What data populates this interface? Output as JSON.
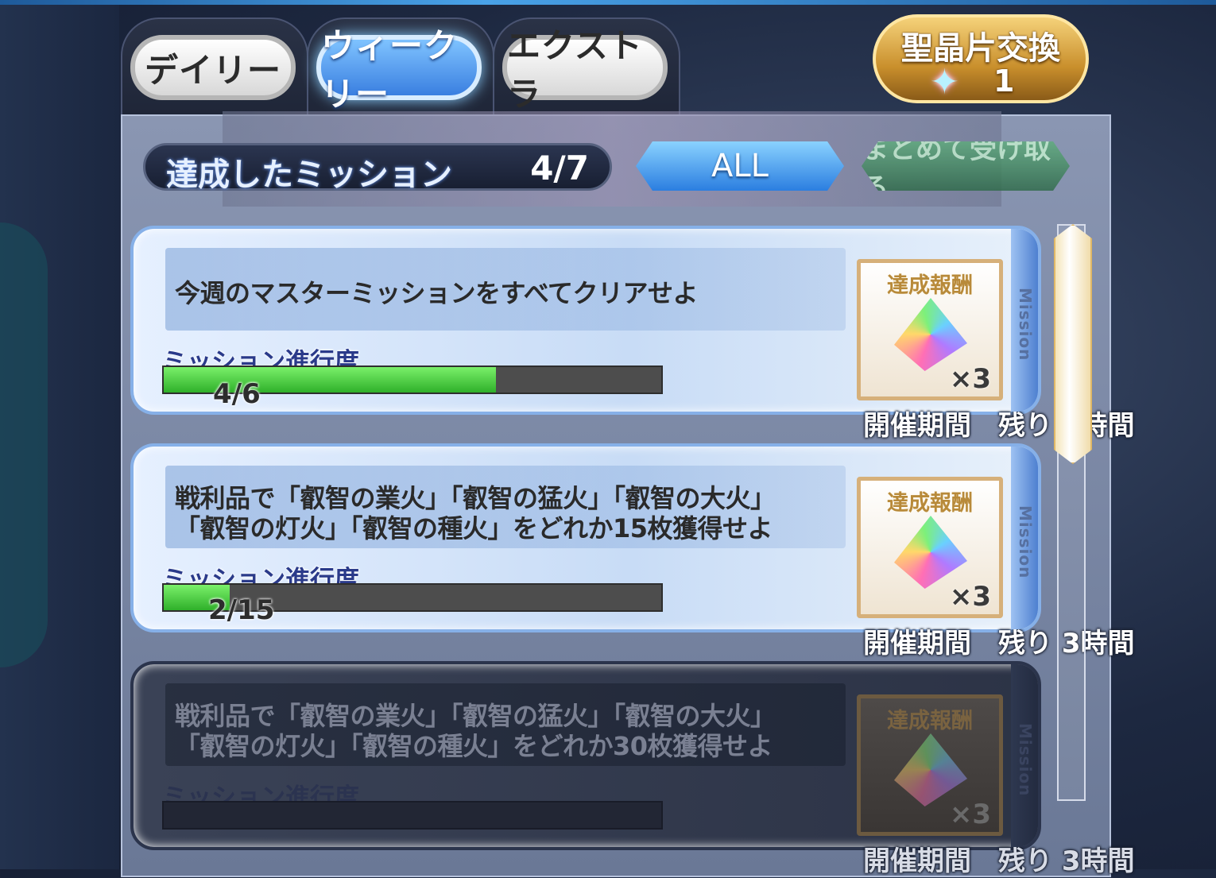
{
  "tabs": [
    {
      "label": "デイリー",
      "active": false
    },
    {
      "label": "ウィークリー",
      "active": true
    },
    {
      "label": "エクストラ",
      "active": false
    }
  ],
  "exchange": {
    "title": "聖晶片交換",
    "count": "1",
    "icon": "saint-quartz-fragment-icon"
  },
  "summary": {
    "label": "達成したミッション",
    "count": "4/7"
  },
  "filter_button": "ALL",
  "collect_all_button": "まとめて受け取る",
  "missions": [
    {
      "text": "今週のマスターミッションをすべてクリアせよ",
      "progress_label": "ミッション進行度",
      "progress_text": "4/6",
      "progress_fraction": 0.667,
      "reward_title": "達成報酬",
      "reward_icon": "saint-quartz-icon",
      "reward_qty": "×3",
      "period": "開催期間　残り 3時間",
      "side_label": "Mission",
      "dimmed": false
    },
    {
      "text": "戦利品で「叡智の業火」「叡智の猛火」「叡智の大火」\n「叡智の灯火」「叡智の種火」をどれか15枚獲得せよ",
      "progress_label": "ミッション進行度",
      "progress_text": "2/15",
      "progress_fraction": 0.133,
      "reward_title": "達成報酬",
      "reward_icon": "saint-quartz-icon",
      "reward_qty": "×3",
      "period": "開催期間　残り 3時間",
      "side_label": "Mission",
      "dimmed": false
    },
    {
      "text": "戦利品で「叡智の業火」「叡智の猛火」「叡智の大火」\n「叡智の灯火」「叡智の種火」をどれか30枚獲得せよ",
      "progress_label": "ミッション進行度",
      "progress_text": "",
      "progress_fraction": 0,
      "reward_title": "達成報酬",
      "reward_icon": "saint-quartz-icon",
      "reward_qty": "×3",
      "period": "開催期間　残り 3時間",
      "side_label": "Mission",
      "dimmed": true
    }
  ],
  "colors": {
    "active_tab": "#3a7fe0",
    "progress_fill": "#2fb02a",
    "exchange_gold": "#c98f2c"
  }
}
